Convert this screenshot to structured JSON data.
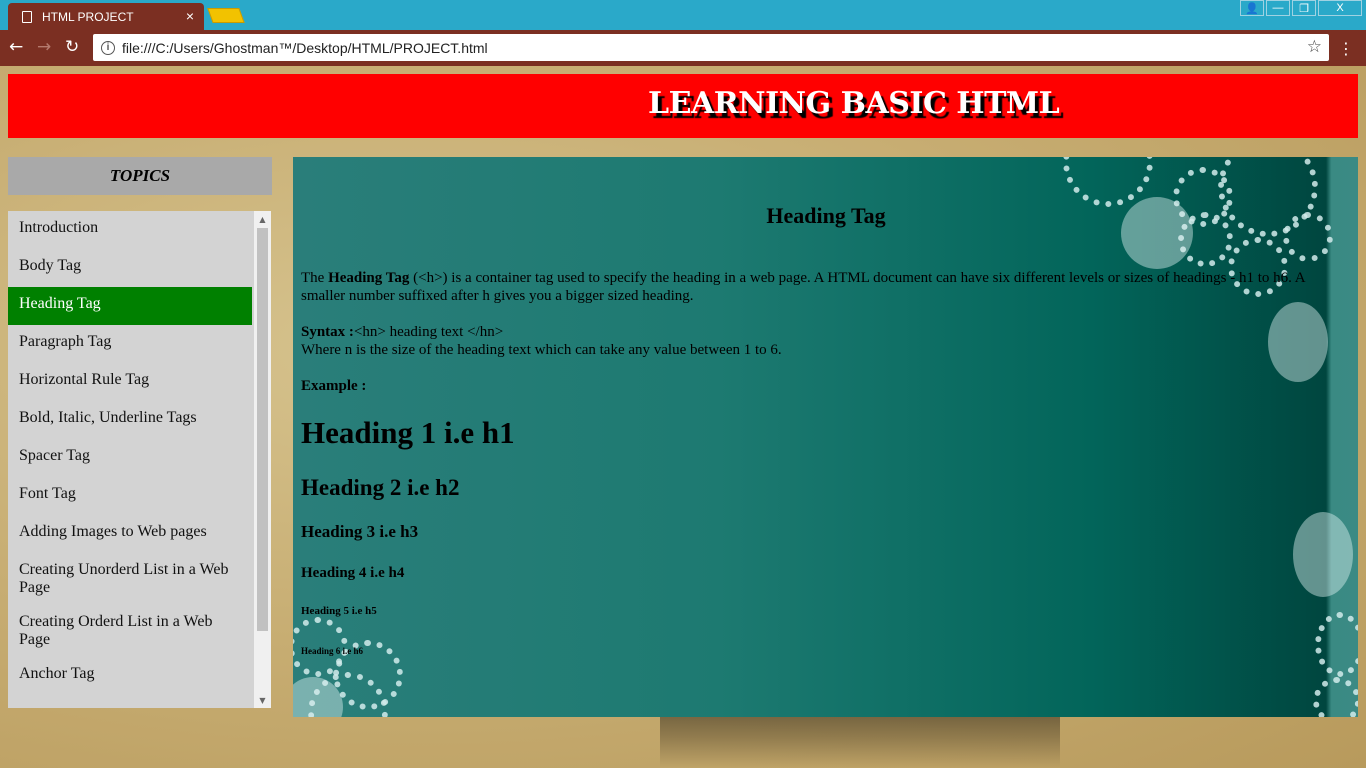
{
  "browser": {
    "tab_title": "HTML PROJECT",
    "tab_close": "×",
    "url": "file:///C:/Users/Ghostman™/Desktop/HTML/PROJECT.html",
    "window_buttons": [
      "👤",
      "—",
      "❐",
      "X"
    ]
  },
  "page": {
    "banner_title": "LEARNING BASIC HTML",
    "topics_label": "TOPICS",
    "topics": [
      {
        "label": "Introduction"
      },
      {
        "label": "Body Tag"
      },
      {
        "label": "Heading Tag",
        "active": true
      },
      {
        "label": "Paragraph Tag"
      },
      {
        "label": "Horizontal Rule Tag"
      },
      {
        "label": "Bold, Italic, Underline Tags"
      },
      {
        "label": "Spacer Tag"
      },
      {
        "label": "Font Tag"
      },
      {
        "label": "Adding Images to Web pages"
      },
      {
        "label": "Creating Unorderd List in a Web Page"
      },
      {
        "label": "Creating Orderd List in a Web Page"
      },
      {
        "label": "Anchor Tag"
      }
    ],
    "content": {
      "title": "Heading Tag",
      "intro_prefix": "The ",
      "intro_bold": "Heading Tag",
      "intro_rest": " (<h>) is a container tag used to specify the heading in a web page. A HTML document can have six different levels or sizes of headings - h1 to h6. A smaller number suffixed after h gives you a bigger sized heading.",
      "syntax_label": "Syntax :",
      "syntax_text": "<hn> heading text </hn>",
      "syntax_note": "Where n is the size of the heading text which can take any value between 1 to 6.",
      "example_label": "Example :",
      "h1": "Heading 1 i.e h1",
      "h2": "Heading 2 i.e h2",
      "h3": "Heading 3 i.e h3",
      "h4": "Heading 4 i.e h4",
      "h5": "Heading 5 i.e h5",
      "h6": "Heading 6 i.e h6"
    }
  },
  "colors": {
    "banner": "#ff0000",
    "active_topic": "#008000",
    "chrome_titlebar": "#2aa9c9",
    "chrome_toolbar": "#7b2f22"
  }
}
